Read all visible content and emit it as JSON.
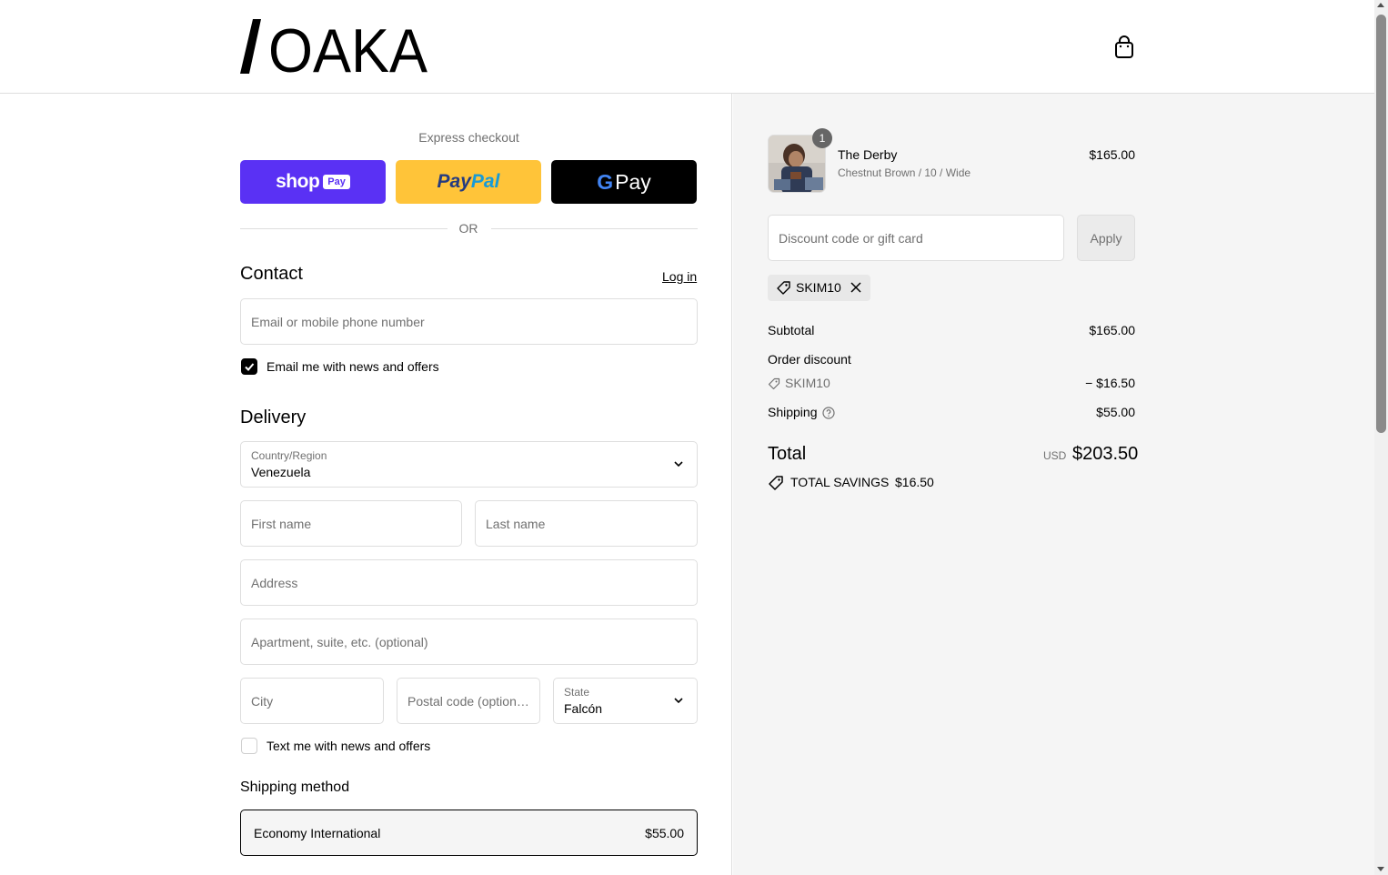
{
  "header": {
    "logo_text": "OAKA",
    "cart_icon": "shopping-bag-icon"
  },
  "express": {
    "title": "Express checkout",
    "shop_label": "shop",
    "shop_pay_label": "Pay",
    "paypal_part1": "Pay",
    "paypal_part2": "Pal",
    "gpay_g": "G",
    "gpay_label": "Pay",
    "or_label": "OR"
  },
  "contact": {
    "title": "Contact",
    "login_label": "Log in",
    "email_placeholder": "Email or mobile phone number",
    "news_label": "Email me with news and offers",
    "news_checked": true
  },
  "delivery": {
    "title": "Delivery",
    "country_label": "Country/Region",
    "country_value": "Venezuela",
    "first_name_placeholder": "First name",
    "last_name_placeholder": "Last name",
    "address_placeholder": "Address",
    "apartment_placeholder": "Apartment, suite, etc. (optional)",
    "city_placeholder": "City",
    "postal_placeholder": "Postal code (optional)",
    "state_label": "State",
    "state_value": "Falcón",
    "text_label": "Text me with news and offers",
    "text_checked": false
  },
  "shipping": {
    "title": "Shipping method",
    "option_name": "Economy International",
    "option_price": "$55.00"
  },
  "summary": {
    "item": {
      "quantity": "1",
      "name": "The Derby",
      "variant": "Chestnut Brown / 10 / Wide",
      "price": "$165.00"
    },
    "discount_placeholder": "Discount code or gift card",
    "apply_label": "Apply",
    "applied_code": "SKIM10",
    "subtotal_label": "Subtotal",
    "subtotal_value": "$165.00",
    "order_discount_label": "Order discount",
    "discount_code": "SKIM10",
    "discount_value": "− $16.50",
    "shipping_label": "Shipping",
    "shipping_value": "$55.00",
    "total_label": "Total",
    "currency": "USD",
    "total_value": "$203.50",
    "savings_label": "TOTAL SAVINGS",
    "savings_value": "$16.50"
  },
  "colors": {
    "shop_pay": "#5a31f4",
    "paypal": "#ffc439",
    "gpay": "#000000",
    "summary_bg": "#f5f5f5"
  }
}
